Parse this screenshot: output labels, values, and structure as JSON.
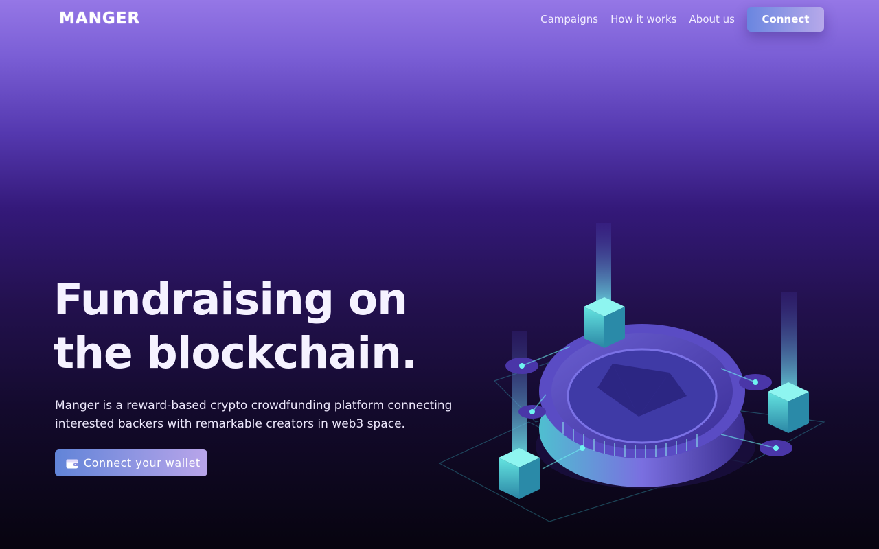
{
  "header": {
    "logo": "MANGER",
    "nav": [
      "Campaigns",
      "How it works",
      "About us"
    ],
    "connect_label": "Connect"
  },
  "hero": {
    "title_line1": "Fundraising on",
    "title_line2": "the blockchain.",
    "description_line1": "Manger is a reward-based crypto crowdfunding platform connecting",
    "description_line2": "interested backers with remarkable creators in web3 space.",
    "wallet_button_label": "Connect your wallet",
    "wallet_icon": "wallet-icon"
  },
  "illustration": {
    "icon": "blockchain-coin-illustration"
  },
  "colors": {
    "accent_start": "#6184d8",
    "accent_end": "#b9a5ea",
    "bg_top": "#9577e6",
    "bg_bottom": "#07040f"
  }
}
